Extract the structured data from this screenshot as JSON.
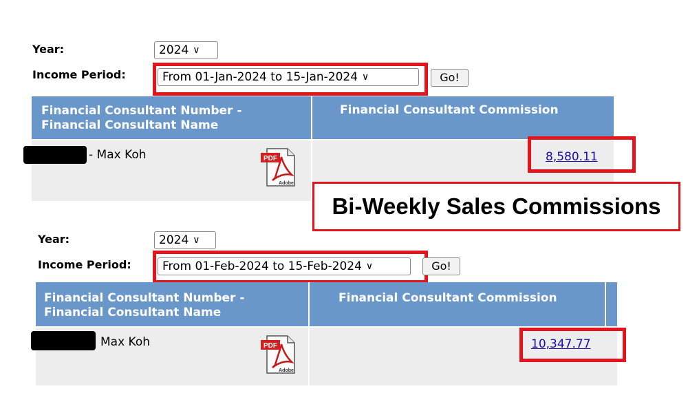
{
  "panels": [
    {
      "year_label": "Year:",
      "year_value": "2024",
      "period_label": "Income Period:",
      "period_value": "From 01-Jan-2024 to 15-Jan-2024",
      "go_label": "Go!",
      "col1_header_line1": "Financial Consultant Number -",
      "col1_header_line2": "Financial Consultant Name",
      "col2_header": "Financial Consultant Commission",
      "consultant_name": "- Max Koh",
      "commission": "8,580.11"
    },
    {
      "year_label": "Year:",
      "year_value": "2024",
      "period_label": "Income Period:",
      "period_value": "From 01-Feb-2024 to 15-Feb-2024",
      "go_label": "Go!",
      "col1_header_line1": "Financial Consultant Number -",
      "col1_header_line2": "Financial Consultant Name",
      "col2_header": "Financial Consultant Commission",
      "consultant_name": "Max Koh",
      "commission": "10,347.77"
    }
  ],
  "caption": "Bi-Weekly Sales Commissions",
  "pdf_icon_label": "PDF",
  "pdf_icon_brand": "Adobe",
  "colors": {
    "header_bg": "#6a97c9",
    "row_bg": "#ededed",
    "highlight_red": "#e3141b",
    "link": "#1a0dab"
  }
}
